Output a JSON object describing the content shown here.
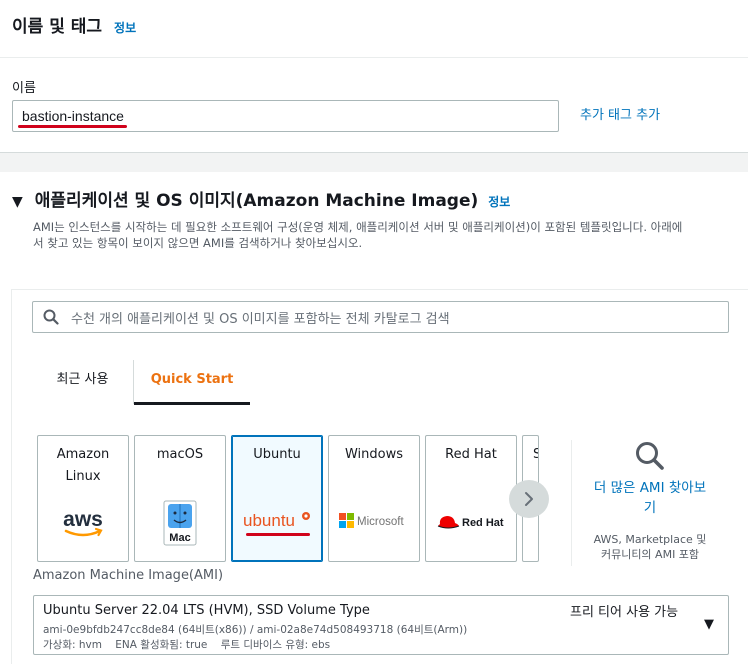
{
  "name_section": {
    "title": "이름 및 태그",
    "info": "정보",
    "name_label": "이름",
    "name_value": "bastion-instance",
    "add_tag": "추가 태그 추가"
  },
  "ami_section": {
    "title": "애플리케이션 및 OS 이미지(Amazon Machine Image)",
    "info": "정보",
    "desc_line1": "AMI는 인스턴스를 시작하는 데 필요한 소프트웨어 구성(운영 체제, 애플리케이션 서버 및 애플리케이션)이 포함된 템플릿입니다. 아래에",
    "desc_line2": "서 찾고 있는 항목이 보이지 않으면 AMI를 검색하거나 찾아보십시오.",
    "search_placeholder": "수천 개의 애플리케이션 및 OS 이미지를 포함하는 전체 카탈로그 검색",
    "tabs": [
      {
        "label": "최근 사용"
      },
      {
        "label": "Quick Start"
      }
    ],
    "tiles": [
      {
        "line1": "Amazon",
        "line2": "Linux",
        "logo": "aws"
      },
      {
        "line1": "macOS",
        "line2": "",
        "logo": "Mac"
      },
      {
        "line1": "Ubuntu",
        "line2": "",
        "logo": "ubuntu"
      },
      {
        "line1": "Windows",
        "line2": "",
        "logo": "Microsoft"
      },
      {
        "line1": "Red Hat",
        "line2": "",
        "logo": "Red Hat"
      },
      {
        "line1": "S",
        "line2": "",
        "logo": ""
      }
    ],
    "browse": {
      "link_line1": "더 많은 AMI 찾아보",
      "link_line2": "기",
      "sub_line1": "AWS, Marketplace 및",
      "sub_line2": "커뮤니티의 AMI 포함"
    },
    "ami_label": "Amazon Machine Image(AMI)",
    "ami_select": {
      "name": "Ubuntu Server 22.04 LTS (HVM), SSD Volume Type",
      "free_tier": "프리 티어 사용 가능",
      "ids": "ami-0e9bfdb247cc8de84 (64비트(x86)) / ami-02a8e74d508493718 (64비트(Arm))",
      "meta": "가상화: hvm    ENA 활성화됨: true    루트 디바이스 유형: ebs"
    }
  },
  "colors": {
    "link": "#0073bb",
    "accent": "#ec7211",
    "highlight": "#d0021b"
  }
}
